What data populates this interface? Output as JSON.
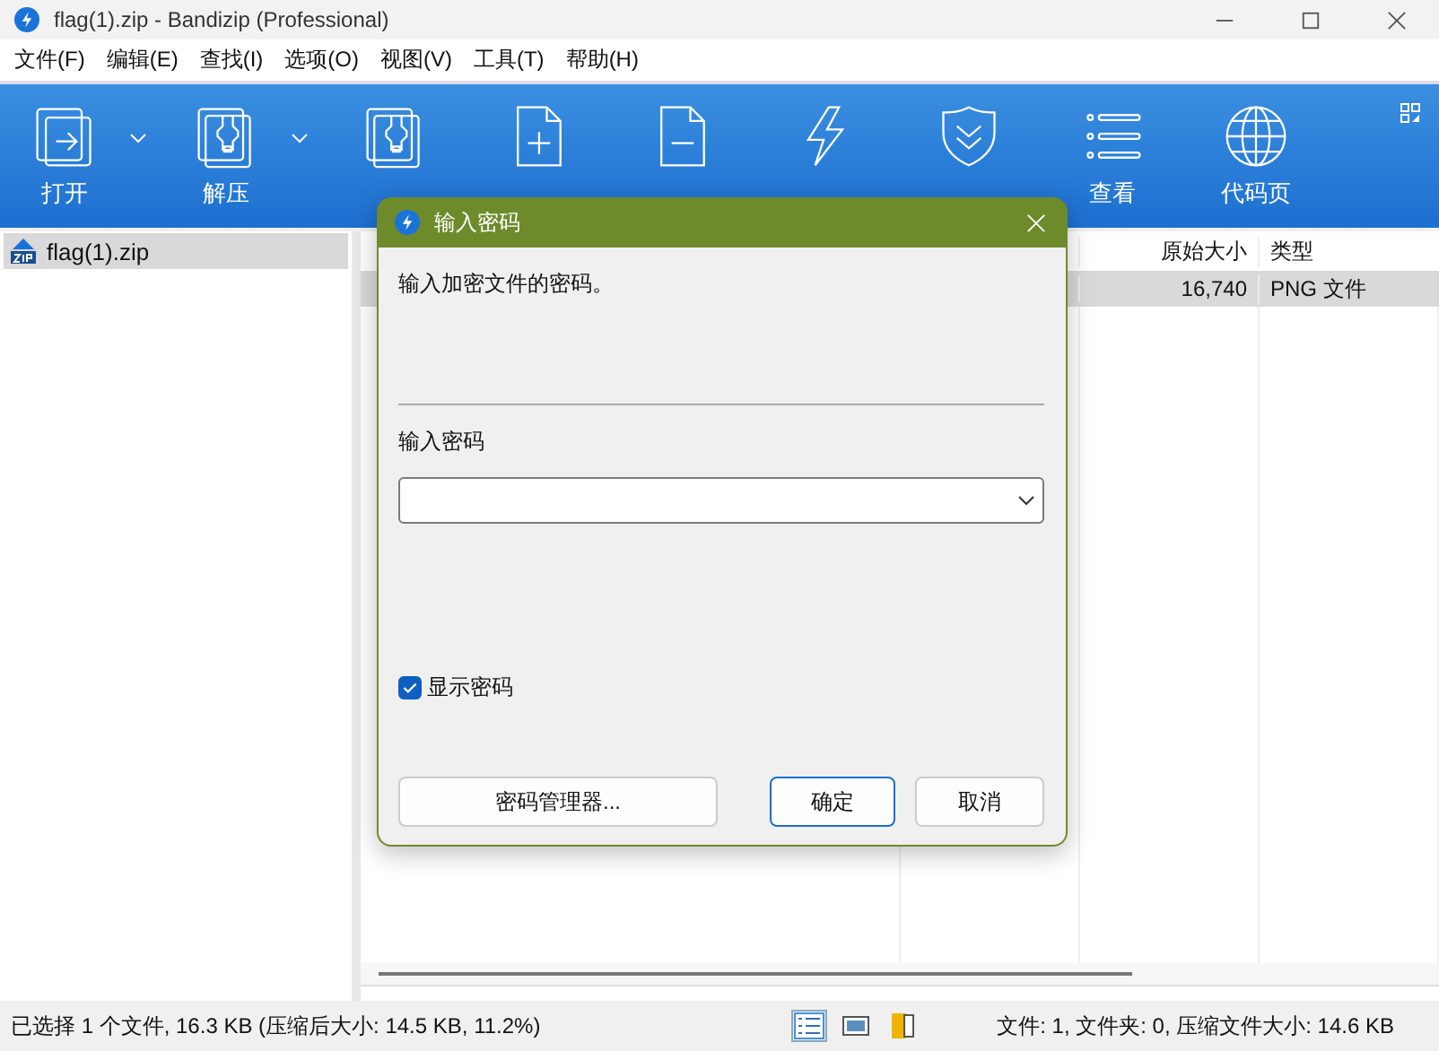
{
  "window": {
    "title": "flag(1).zip - Bandizip (Professional)"
  },
  "menu": [
    "文件(F)",
    "编辑(E)",
    "查找(I)",
    "选项(O)",
    "视图(V)",
    "工具(T)",
    "帮助(H)"
  ],
  "toolbar": [
    {
      "label": "打开",
      "dropdown": true
    },
    {
      "label": "解压",
      "dropdown": true
    },
    {
      "dropdown": false
    },
    {
      "dropdown": false
    },
    {
      "dropdown": false
    },
    {
      "dropdown": false
    },
    {
      "dropdown": false
    },
    {
      "label": "查看",
      "dropdown": false
    },
    {
      "label": "代码页",
      "dropdown": false
    }
  ],
  "tree": [
    {
      "label": "flag(1).zip",
      "selected": true
    }
  ],
  "table": {
    "columns": [
      "原始大小",
      "类型"
    ],
    "rows": [
      {
        "cells": [
          "16,740",
          "PNG 文件"
        ],
        "selected": true
      }
    ]
  },
  "dialog": {
    "title": "输入密码",
    "message": "输入加密文件的密码。",
    "field_label": "输入密码",
    "show_password": {
      "label": "显示密码",
      "checked": true
    },
    "buttons": [
      {
        "label": "密码管理器...",
        "default": false
      },
      {
        "label": "确定",
        "default": true
      },
      {
        "label": "取消",
        "default": false
      }
    ]
  },
  "status_bar": {
    "left": "已选择 1 个文件, 16.3 KB (压缩后大小: 14.5 KB, 11.2%)",
    "right": "文件: 1, 文件夹: 0, 压缩文件大小: 14.6 KB"
  }
}
